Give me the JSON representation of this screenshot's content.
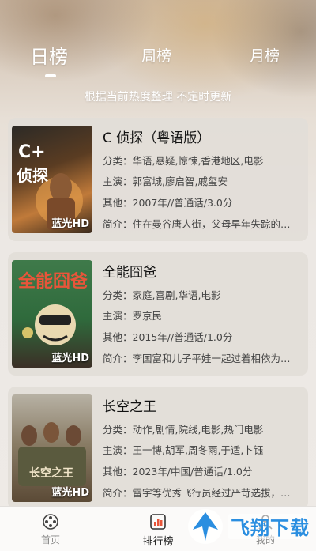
{
  "tabs": [
    {
      "label": "日榜",
      "active": true
    },
    {
      "label": "周榜",
      "active": false
    },
    {
      "label": "月榜",
      "active": false
    }
  ],
  "subtitle": "根据当前热度整理 不定时更新",
  "movies": [
    {
      "title": "C 侦探（粤语版）",
      "category": "分类：华语,悬疑,惊悚,香港地区,电影",
      "cast": "主演：郭富城,廖启智,戚玺安",
      "other": "其他：2007年//普通话/3.0分",
      "intro": "简介：住在曼谷唐人街，父母早年失踪的…",
      "badge": "蓝光HD",
      "poster_text": "C+侦探"
    },
    {
      "title": "全能囧爸",
      "category": "分类：家庭,喜剧,华语,电影",
      "cast": "主演：罗京民",
      "other": "其他：2015年//普通话/1.0分",
      "intro": "简介：李国富和儿子平娃一起过着相依为…",
      "badge": "蓝光HD",
      "poster_text": "全能囧爸"
    },
    {
      "title": "长空之王",
      "category": "分类：动作,剧情,院线,电影,热门电影",
      "cast": "主演：王一博,胡军,周冬雨,于适,卜钰",
      "other": "其他：2023年/中国/普通话/1.0分",
      "intro": "简介：雷宇等优秀飞行员经过严苛选拔，…",
      "badge": "蓝光HD",
      "poster_text": "长空之王"
    }
  ],
  "bottom_nav": [
    {
      "label": "首页",
      "icon": "film-reel-icon",
      "active": false
    },
    {
      "label": "排行榜",
      "icon": "chart-icon",
      "active": true
    },
    {
      "label": "我的",
      "icon": "user-icon",
      "active": false
    }
  ],
  "watermark": "飞翔下载",
  "colors": {
    "accent": "#e8553a",
    "watermark": "#2a8ee0"
  }
}
